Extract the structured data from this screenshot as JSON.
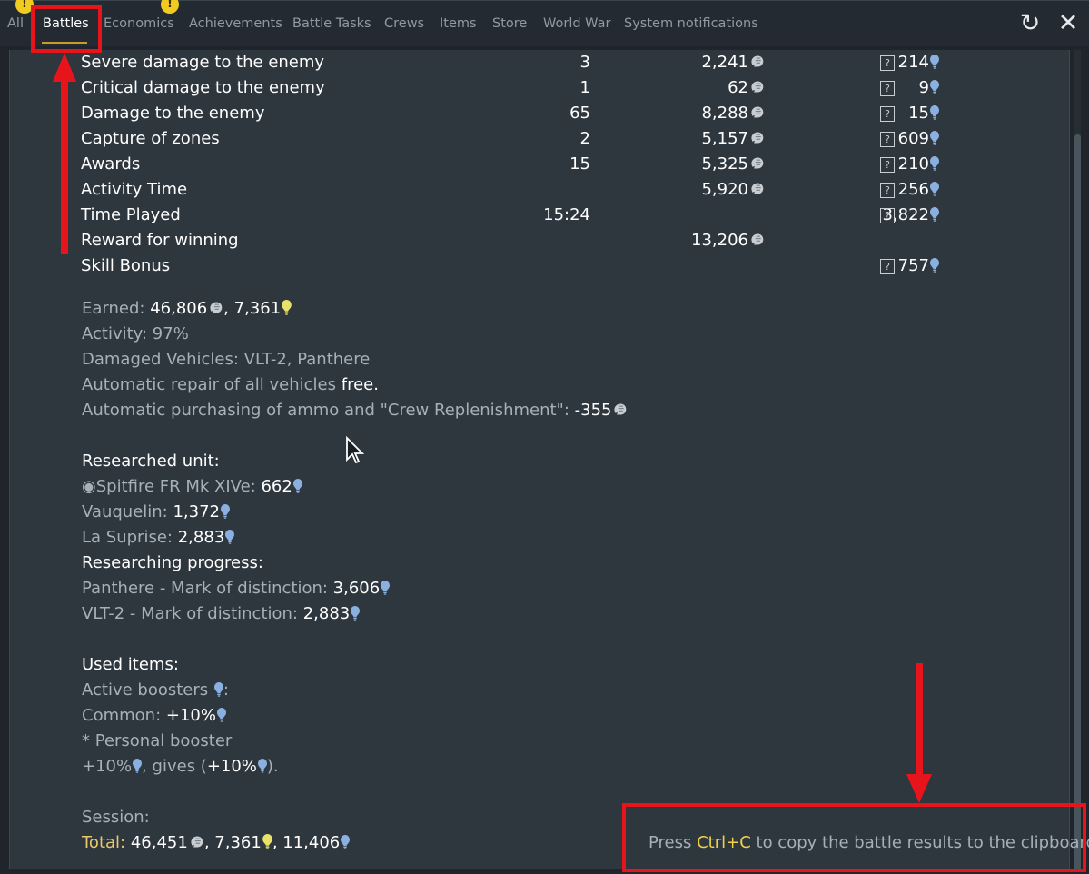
{
  "tabs": [
    {
      "label": "All",
      "warn": true
    },
    {
      "label": "Battles",
      "active": true
    },
    {
      "label": "Economics",
      "warn": true
    },
    {
      "label": "Achievements"
    },
    {
      "label": "Battle Tasks"
    },
    {
      "label": "Crews"
    },
    {
      "label": "Items"
    },
    {
      "label": "Store"
    },
    {
      "label": "World War"
    },
    {
      "label": "System notifications"
    }
  ],
  "icons": {
    "warn_glyph": "!",
    "refresh_glyph": "↻",
    "close_glyph": "✕",
    "help_glyph": "?",
    "radio_glyph": "◉"
  },
  "colors": {
    "accent_gold": "#c99a2e",
    "annotation_red": "#e8141c",
    "warning_yellow": "#f1cb22",
    "rp_blue": "#8ab0e0",
    "silver_lion": "#c8cdd2",
    "gold_bulb": "#e8e16a"
  },
  "table_rows": [
    {
      "name": "Severe damage to the enemy",
      "count": "3",
      "silver": "2,241",
      "rp": "214",
      "help": true
    },
    {
      "name": "Critical damage to the enemy",
      "count": "1",
      "silver": "62",
      "rp": "9",
      "help": true
    },
    {
      "name": "Damage to the enemy",
      "count": "65",
      "silver": "8,288",
      "rp": "15",
      "help": true
    },
    {
      "name": "Capture of zones",
      "count": "2",
      "silver": "5,157",
      "rp": "609",
      "help": true
    },
    {
      "name": "Awards",
      "count": "15",
      "silver": "5,325",
      "rp": "210",
      "help": true
    },
    {
      "name": "Activity Time",
      "count": "",
      "silver": "5,920",
      "rp": "256",
      "help": true
    },
    {
      "name": "Time Played",
      "count": "15:24",
      "silver": "",
      "rp": "3,822",
      "help": true
    },
    {
      "name": "Reward for winning",
      "count": "",
      "silver": "13,206",
      "rp": "",
      "help": false
    },
    {
      "name": "Skill Bonus",
      "count": "",
      "silver": "",
      "rp": "757",
      "help": true
    }
  ],
  "summary": {
    "earned_label": "Earned: ",
    "earned_silver": "46,806",
    "earned_sep": ", ",
    "earned_rp": "7,361",
    "activity": "Activity: 97%",
    "damaged": "Damaged Vehicles: VLT-2, Panthere",
    "repair_label": "Automatic repair of all vehicles ",
    "repair_value": "free.",
    "ammo_label": "Automatic purchasing of ammo and \"Crew Replenishment\": ",
    "ammo_value": "-355"
  },
  "research": {
    "researched_header": "Researched unit:",
    "units": [
      {
        "label": "Spitfire FR Mk XIVe: ",
        "value": "662",
        "radio": true
      },
      {
        "label": "Vauquelin: ",
        "value": "1,372",
        "radio": false
      },
      {
        "label": "La Suprise: ",
        "value": "2,883",
        "radio": false
      }
    ],
    "progress_header": "Researching progress:",
    "progress": [
      {
        "label": "Panthere - Mark of distinction: ",
        "value": "3,606"
      },
      {
        "label": "VLT-2 - Mark of distinction: ",
        "value": "2,883"
      }
    ]
  },
  "items": {
    "header": "Used items:",
    "active_boosters": "Active boosters ",
    "active_colon": ":",
    "common_label": "Common: ",
    "common_value": "+10%",
    "personal": "* Personal booster",
    "pb_value": "+10%",
    "pb_gives": ", gives (",
    "pb_value2": "+10%",
    "pb_end": ")."
  },
  "session": {
    "header": "Session:",
    "total_label": "Total:",
    "total_silver": "46,451",
    "sep1": ", ",
    "total_gold": "7,361",
    "sep2": ", ",
    "total_rp": "11,406"
  },
  "clipboard_hint": {
    "pre": "Press ",
    "key": "Ctrl+C",
    "post": " to copy the battle results to the clipboard"
  }
}
